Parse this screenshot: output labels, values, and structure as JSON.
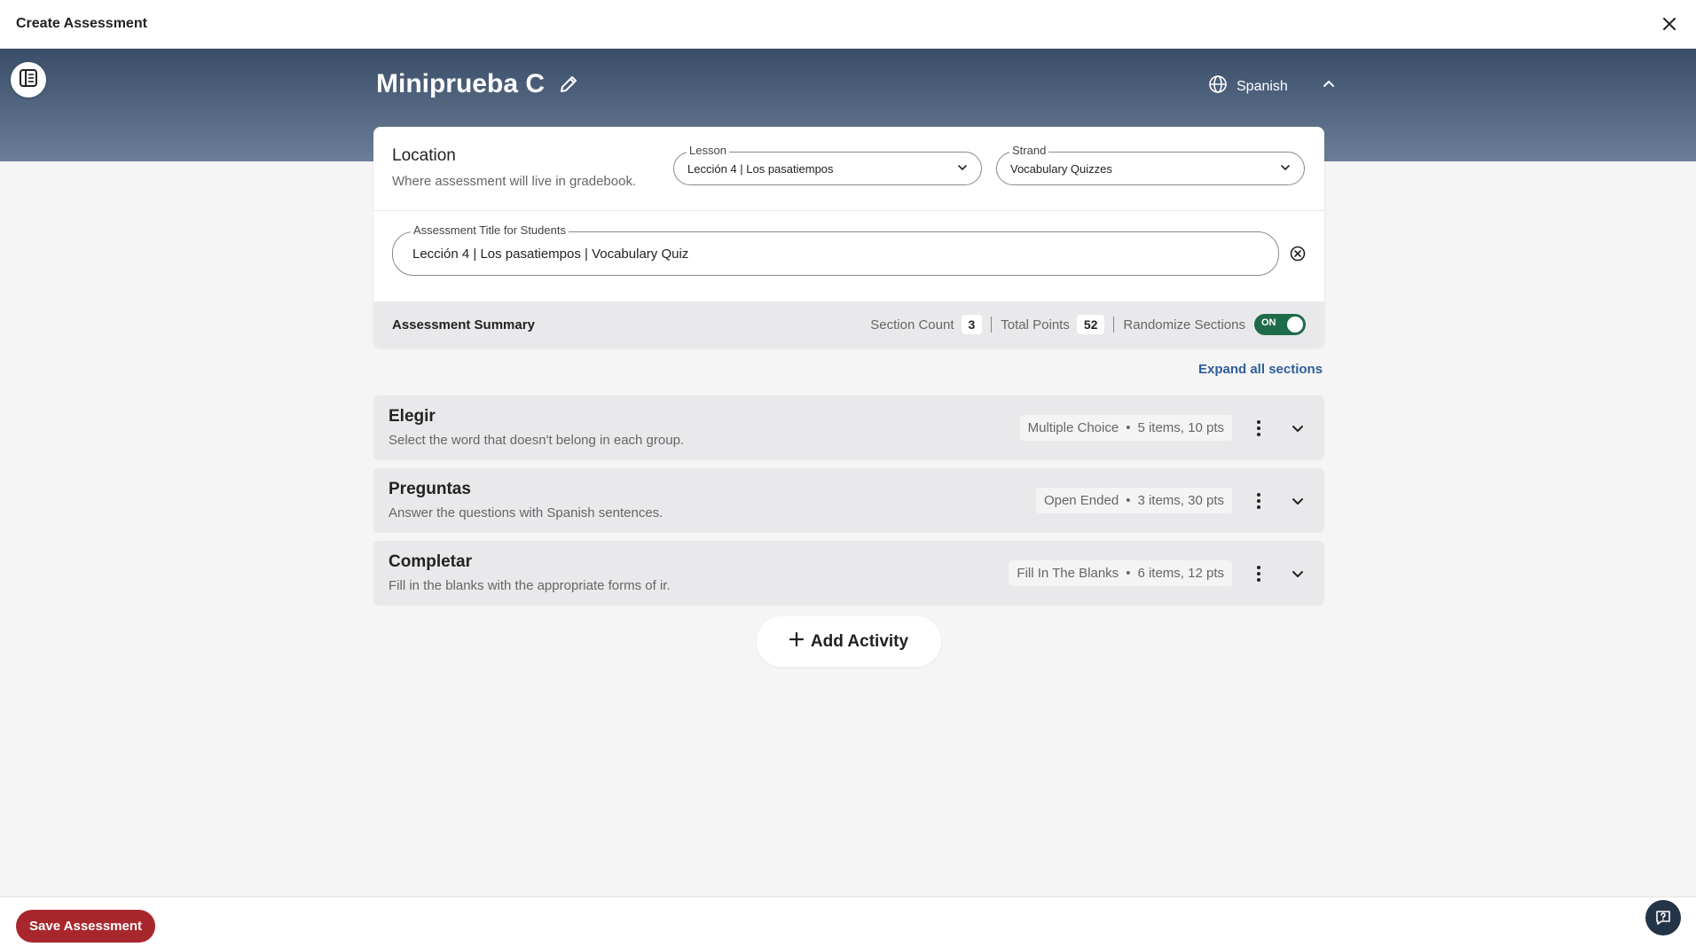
{
  "topbar": {
    "title": "Create Assessment",
    "close_icon": "close-icon"
  },
  "header": {
    "title": "Miniprueba C",
    "language": "Spanish"
  },
  "location": {
    "title": "Location",
    "subtitle": "Where assessment will live in gradebook.",
    "lesson_label": "Lesson",
    "lesson_value": "Lección 4 | Los pasatiempos",
    "strand_label": "Strand",
    "strand_value": "Vocabulary Quizzes"
  },
  "assessment_title": {
    "label": "Assessment Title for Students",
    "value": "Lección 4 | Los pasatiempos | Vocabulary Quiz"
  },
  "summary": {
    "title": "Assessment Summary",
    "section_count_label": "Section Count",
    "section_count": "3",
    "total_points_label": "Total Points",
    "total_points": "52",
    "randomize_label": "Randomize Sections",
    "randomize_state": "ON"
  },
  "expand_all": "Expand all sections",
  "sections": [
    {
      "title": "Elegir",
      "description": "Select the word that doesn't belong in each group.",
      "type": "Multiple Choice",
      "detail": "5 items, 10 pts"
    },
    {
      "title": "Preguntas",
      "description": "Answer the questions with Spanish sentences.",
      "type": "Open Ended",
      "detail": "3 items, 30 pts"
    },
    {
      "title": "Completar",
      "description": "Fill in the blanks with the appropriate forms of ir.",
      "type": "Fill In The Blanks",
      "detail": "6 items, 12 pts"
    }
  ],
  "add_activity": "Add Activity",
  "footer": {
    "save_label": "Save Assessment"
  },
  "colors": {
    "accent": "#a8272d",
    "link": "#2f5d9a",
    "toggle_on": "#1e6b4a",
    "hero_top": "#3a4d68"
  }
}
